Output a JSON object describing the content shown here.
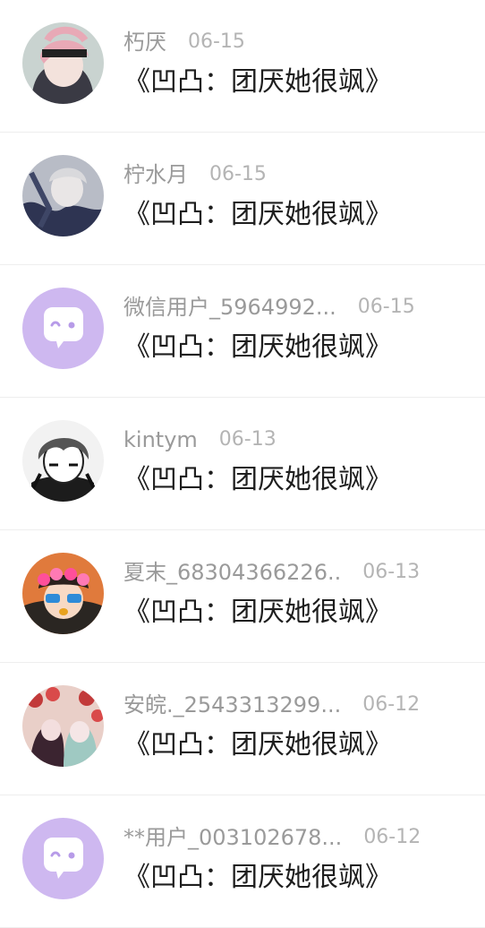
{
  "comments": [
    {
      "user": "朽厌",
      "date": "06-15",
      "message": "《凹凸：团厌她很飒》",
      "avatar": "anime-avatar-pink-hair"
    },
    {
      "user": "柠水月",
      "date": "06-15",
      "message": "《凹凸：团厌她很飒》",
      "avatar": "anime-avatar-grey-hair"
    },
    {
      "user": "微信用户_5964992...",
      "date": "06-15",
      "message": "《凹凸：团厌她很飒》",
      "avatar": "default-chat-bubble-avatar"
    },
    {
      "user": "kintym",
      "date": "06-13",
      "message": "《凹凸：团厌她很飒》",
      "avatar": "anime-avatar-monochrome"
    },
    {
      "user": "夏末_68304366226..",
      "date": "06-13",
      "message": "《凹凸：团厌她很飒》",
      "avatar": "anime-avatar-flower-crown"
    },
    {
      "user": "安皖._2543313299...",
      "date": "06-12",
      "message": "《凹凸：团厌她很飒》",
      "avatar": "anime-avatar-two-girls-roses"
    },
    {
      "user": "**用户_003102678...",
      "date": "06-12",
      "message": "《凹凸：团厌她很飒》",
      "avatar": "default-chat-bubble-avatar"
    }
  ]
}
